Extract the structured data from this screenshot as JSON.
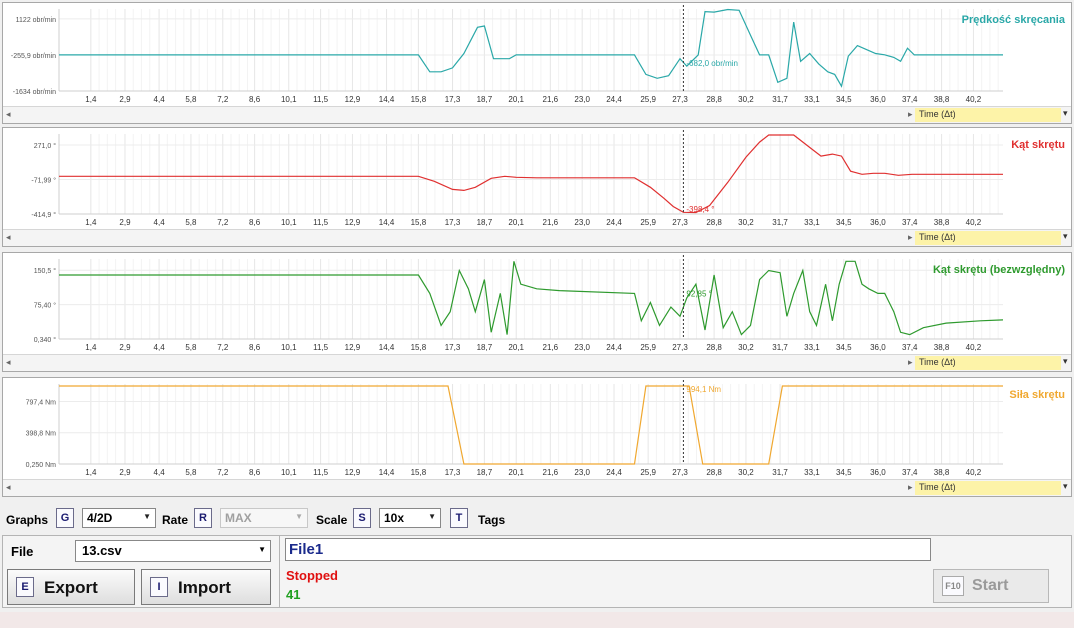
{
  "chart_data": [
    {
      "type": "line",
      "title": "Prędkość skręcania",
      "color": "#2aa8a8",
      "y_ticks": [
        "1122 obr/min",
        "-255,9 obr/min",
        "-1634 obr/min"
      ],
      "ylim": [
        -1634,
        1500
      ],
      "x_ticks": [
        "1,4",
        "2,9",
        "4,4",
        "5,8",
        "7,2",
        "8,6",
        "10,1",
        "11,5",
        "12,9",
        "14,4",
        "15,8",
        "17,3",
        "18,7",
        "20,1",
        "21,6",
        "23,0",
        "24,4",
        "25,9",
        "27,3",
        "28,8",
        "30,2",
        "31,7",
        "33,1",
        "34,5",
        "36,0",
        "37,4",
        "38,8",
        "40,2"
      ],
      "xlim": [
        0,
        41.5
      ],
      "cursor": {
        "x": 27.45,
        "label": "-682,0 obr/min"
      },
      "points": [
        [
          0,
          -255.9
        ],
        [
          15.8,
          -255.9
        ],
        [
          16.3,
          -900
        ],
        [
          16.8,
          -900
        ],
        [
          17.3,
          -750
        ],
        [
          17.8,
          -200
        ],
        [
          18.4,
          800
        ],
        [
          18.7,
          850
        ],
        [
          19.1,
          -400
        ],
        [
          19.8,
          -400
        ],
        [
          20.1,
          -255.9
        ],
        [
          25.3,
          -255.9
        ],
        [
          25.8,
          -1000
        ],
        [
          26.3,
          -1150
        ],
        [
          26.8,
          -1050
        ],
        [
          27.3,
          -400
        ],
        [
          27.6,
          -682
        ],
        [
          28.1,
          -255.9
        ],
        [
          28.4,
          1400
        ],
        [
          28.8,
          1380
        ],
        [
          29.4,
          1480
        ],
        [
          29.9,
          1450
        ],
        [
          30.4,
          500
        ],
        [
          30.8,
          -255.9
        ],
        [
          31.2,
          -255.9
        ],
        [
          31.6,
          -1300
        ],
        [
          32.0,
          -1150
        ],
        [
          32.3,
          1000
        ],
        [
          32.6,
          -500
        ],
        [
          33.0,
          -200
        ],
        [
          33.4,
          -600
        ],
        [
          33.8,
          -900
        ],
        [
          34.1,
          -1000
        ],
        [
          34.4,
          -1450
        ],
        [
          34.7,
          -300
        ],
        [
          35.1,
          100
        ],
        [
          35.5,
          -50
        ],
        [
          35.9,
          -200
        ],
        [
          36.3,
          -250
        ],
        [
          36.7,
          -350
        ],
        [
          37.0,
          -500
        ],
        [
          37.3,
          0
        ],
        [
          37.6,
          -255.9
        ],
        [
          41.5,
          -255.9
        ]
      ]
    },
    {
      "type": "line",
      "title": "Kąt skrętu",
      "color": "#e03030",
      "y_ticks": [
        "271,0 °",
        "-71,99 °",
        "-414,9 °"
      ],
      "ylim": [
        -414.9,
        380
      ],
      "x_ticks": [
        "1,4",
        "2,9",
        "4,4",
        "5,8",
        "7,2",
        "8,6",
        "10,1",
        "11,5",
        "12,9",
        "14,4",
        "15,8",
        "17,3",
        "18,7",
        "20,1",
        "21,6",
        "23,0",
        "24,4",
        "25,9",
        "27,3",
        "28,8",
        "30,2",
        "31,7",
        "33,1",
        "34,5",
        "36,0",
        "37,4",
        "38,8",
        "40,2"
      ],
      "xlim": [
        0,
        41.5
      ],
      "cursor": {
        "x": 27.45,
        "label": "-398,4 °"
      },
      "points": [
        [
          0,
          -40
        ],
        [
          15.8,
          -40
        ],
        [
          16.5,
          -90
        ],
        [
          17.3,
          -170
        ],
        [
          17.8,
          -180
        ],
        [
          18.3,
          -150
        ],
        [
          19.0,
          -60
        ],
        [
          19.6,
          -40
        ],
        [
          20.1,
          -50
        ],
        [
          21.0,
          -55
        ],
        [
          25.3,
          -55
        ],
        [
          26.0,
          -150
        ],
        [
          26.6,
          -260
        ],
        [
          27.0,
          -340
        ],
        [
          27.45,
          -398
        ],
        [
          28.0,
          -400
        ],
        [
          28.6,
          -330
        ],
        [
          29.4,
          -100
        ],
        [
          30.2,
          150
        ],
        [
          30.8,
          300
        ],
        [
          31.2,
          370
        ],
        [
          32.3,
          370
        ],
        [
          33.1,
          230
        ],
        [
          33.5,
          160
        ],
        [
          34.0,
          180
        ],
        [
          34.4,
          160
        ],
        [
          34.8,
          10
        ],
        [
          35.3,
          -20
        ],
        [
          35.8,
          -10
        ],
        [
          36.3,
          -10
        ],
        [
          36.9,
          -30
        ],
        [
          37.5,
          -20
        ],
        [
          41.5,
          -20
        ]
      ]
    },
    {
      "type": "line",
      "title": "Kąt skrętu (bezwzględny)",
      "color": "#2e9a2e",
      "y_ticks": [
        "150,5 °",
        "75,40 °",
        "0,340 °"
      ],
      "ylim": [
        0.34,
        175
      ],
      "x_ticks": [
        "1,4",
        "2,9",
        "4,4",
        "5,8",
        "7,2",
        "8,6",
        "10,1",
        "11,5",
        "12,9",
        "14,4",
        "15,8",
        "17,3",
        "18,7",
        "20,1",
        "21,6",
        "23,0",
        "24,4",
        "25,9",
        "27,3",
        "28,8",
        "30,2",
        "31,7",
        "33,1",
        "34,5",
        "36,0",
        "37,4",
        "38,8",
        "40,2"
      ],
      "xlim": [
        0,
        41.5
      ],
      "cursor": {
        "x": 27.45,
        "label": "92,85 °"
      },
      "points": [
        [
          0,
          140
        ],
        [
          15.8,
          140
        ],
        [
          16.3,
          100
        ],
        [
          16.8,
          30
        ],
        [
          17.2,
          60
        ],
        [
          17.6,
          150
        ],
        [
          18.0,
          110
        ],
        [
          18.3,
          60
        ],
        [
          18.7,
          130
        ],
        [
          19.0,
          15
        ],
        [
          19.4,
          100
        ],
        [
          19.7,
          10
        ],
        [
          20.0,
          170
        ],
        [
          20.3,
          120
        ],
        [
          21.0,
          110
        ],
        [
          22.0,
          106
        ],
        [
          25.3,
          100
        ],
        [
          25.6,
          40
        ],
        [
          26.0,
          80
        ],
        [
          26.4,
          30
        ],
        [
          26.9,
          70
        ],
        [
          27.3,
          50
        ],
        [
          27.6,
          90
        ],
        [
          28.0,
          120
        ],
        [
          28.4,
          20
        ],
        [
          28.8,
          140
        ],
        [
          29.2,
          25
        ],
        [
          29.6,
          60
        ],
        [
          30.0,
          10
        ],
        [
          30.4,
          30
        ],
        [
          30.8,
          130
        ],
        [
          31.2,
          150
        ],
        [
          31.7,
          145
        ],
        [
          32.0,
          50
        ],
        [
          32.3,
          100
        ],
        [
          32.7,
          150
        ],
        [
          33.0,
          60
        ],
        [
          33.3,
          30
        ],
        [
          33.7,
          120
        ],
        [
          34.0,
          40
        ],
        [
          34.3,
          120
        ],
        [
          34.6,
          170
        ],
        [
          35.0,
          170
        ],
        [
          35.3,
          120
        ],
        [
          35.6,
          110
        ],
        [
          36.0,
          100
        ],
        [
          36.3,
          100
        ],
        [
          36.7,
          60
        ],
        [
          37.0,
          15
        ],
        [
          37.4,
          10
        ],
        [
          38.0,
          25
        ],
        [
          39.0,
          35
        ],
        [
          40.5,
          40
        ],
        [
          41.5,
          42
        ]
      ]
    },
    {
      "type": "line",
      "title": "Siła skrętu",
      "color": "#f0a830",
      "y_ticks": [
        "797,4 Nm",
        "398,8 Nm",
        "0,250 Nm"
      ],
      "ylim": [
        0.25,
        1020
      ],
      "x_ticks": [
        "1,4",
        "2,9",
        "4,4",
        "5,8",
        "7,2",
        "8,6",
        "10,1",
        "11,5",
        "12,9",
        "14,4",
        "15,8",
        "17,3",
        "18,7",
        "20,1",
        "21,6",
        "23,0",
        "24,4",
        "25,9",
        "27,3",
        "28,8",
        "30,2",
        "31,7",
        "33,1",
        "34,5",
        "36,0",
        "37,4",
        "38,8",
        "40,2"
      ],
      "xlim": [
        0,
        41.5
      ],
      "cursor": {
        "x": 27.45,
        "label": "994,1 Nm"
      },
      "points": [
        [
          0,
          994
        ],
        [
          17.1,
          994
        ],
        [
          17.8,
          0.25
        ],
        [
          25.3,
          0.25
        ],
        [
          25.8,
          994
        ],
        [
          27.7,
          994
        ],
        [
          28.3,
          0.25
        ],
        [
          31.2,
          0.25
        ],
        [
          31.8,
          994
        ],
        [
          41.5,
          994
        ]
      ]
    }
  ],
  "axis_select_label": "Time (Δt)",
  "toolbar": {
    "graphs_label": "Graphs",
    "graphs_key": "G",
    "graphs_value": "4/2D",
    "rate_label": "Rate",
    "rate_key": "R",
    "rate_value": "MAX",
    "scale_label": "Scale",
    "scale_key": "S",
    "scale_value": "10x",
    "tags_key": "T",
    "tags_label": "Tags"
  },
  "file": {
    "label": "File",
    "value": "13.csv"
  },
  "export": {
    "key": "E",
    "label": "Export"
  },
  "import": {
    "key": "I",
    "label": "Import"
  },
  "name_field": "File1",
  "status": "Stopped",
  "count": "41",
  "start": {
    "key": "F10",
    "label": "Start"
  }
}
